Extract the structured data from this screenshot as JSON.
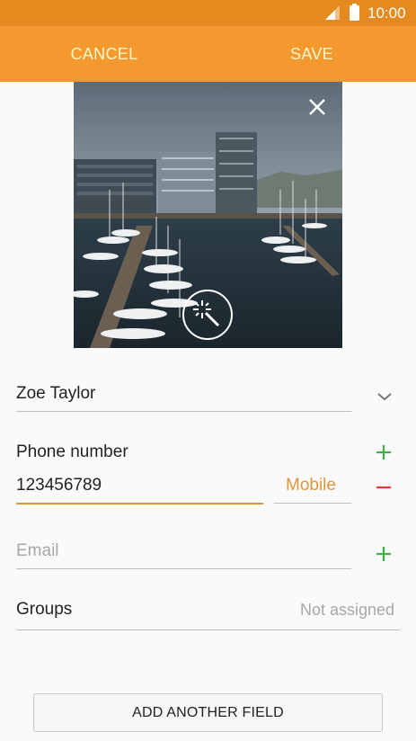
{
  "status_bar": {
    "time": "10:00",
    "signal_icon": "signal-icon",
    "battery_icon": "battery-icon"
  },
  "action_bar": {
    "cancel_label": "CANCEL",
    "save_label": "SAVE"
  },
  "photo": {
    "close_icon": "close-icon",
    "effect_icon": "magic-wand-icon"
  },
  "name_field": {
    "value": "Zoe Taylor",
    "expand_icon": "chevron-down-icon"
  },
  "phone": {
    "label": "Phone number",
    "value": "123456789",
    "type": "Mobile",
    "add_icon": "plus-icon",
    "remove_icon": "minus-icon"
  },
  "email": {
    "placeholder": "Email",
    "add_icon": "plus-icon"
  },
  "groups": {
    "label": "Groups",
    "value": "Not assigned"
  },
  "add_field_button": {
    "label": "ADD ANOTHER FIELD"
  },
  "colors": {
    "status_bar": "#e48a1f",
    "action_bar": "#f3992f",
    "action_text": "#fff6c8",
    "accent": "#e0953b",
    "add": "#3fae49",
    "remove": "#e53935"
  }
}
